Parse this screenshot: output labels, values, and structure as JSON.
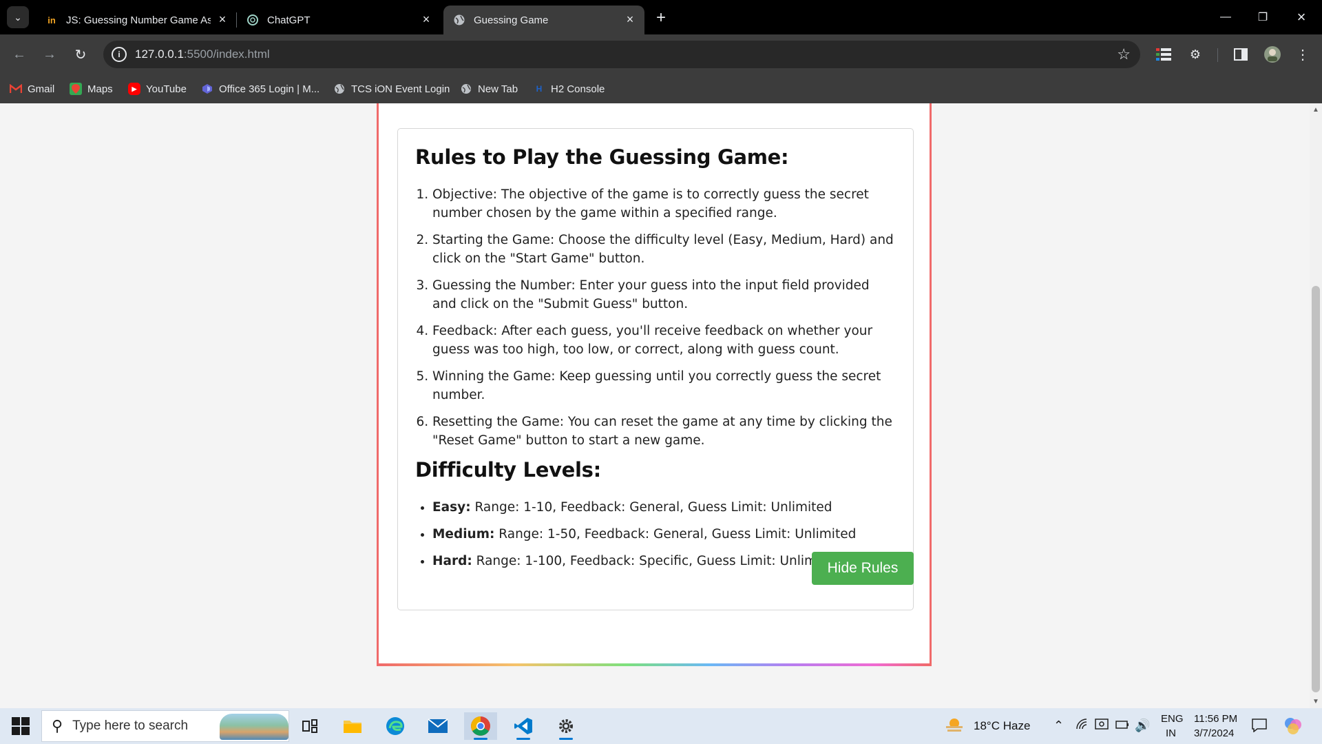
{
  "browser": {
    "tabs": [
      {
        "title": "JS: Guessing Number Game Ass",
        "favicon": "in",
        "active": false
      },
      {
        "title": "ChatGPT",
        "favicon": "openai-icon",
        "active": false
      },
      {
        "title": "Guessing Game",
        "favicon": "globe-icon",
        "active": true
      }
    ],
    "url_host": "127.0.0.1",
    "url_path": ":5500/index.html",
    "bookmarks": [
      {
        "label": "Gmail"
      },
      {
        "label": "Maps"
      },
      {
        "label": "YouTube"
      },
      {
        "label": "Office 365 Login | M..."
      },
      {
        "label": "TCS iON Event Login"
      },
      {
        "label": "New Tab"
      },
      {
        "label": "H2 Console"
      }
    ]
  },
  "page": {
    "rules_title": "Rules to Play the Guessing Game:",
    "rules": [
      "Objective: The objective of the game is to correctly guess the secret number chosen by the game within a specified range.",
      "Starting the Game: Choose the difficulty level (Easy, Medium, Hard) and click on the \"Start Game\" button.",
      "Guessing the Number: Enter your guess into the input field provided and click on the \"Submit Guess\" button.",
      "Feedback: After each guess, you'll receive feedback on whether your guess was too high, too low, or correct, along with guess count.",
      "Winning the Game: Keep guessing until you correctly guess the secret number.",
      "Resetting the Game: You can reset the game at any time by clicking the \"Reset Game\" button to start a new game."
    ],
    "difficulty_title": "Difficulty Levels:",
    "levels": [
      {
        "name": "Easy:",
        "desc": "Range: 1-10, Feedback: General, Guess Limit: Unlimited"
      },
      {
        "name": "Medium:",
        "desc": "Range: 1-50, Feedback: General, Guess Limit: Unlimited"
      },
      {
        "name": "Hard:",
        "desc": "Range: 1-100, Feedback: Specific, Guess Limit: Unlimited"
      }
    ],
    "hide_rules_label": "Hide Rules",
    "colors": {
      "accent_button": "#4caf50",
      "container_border": "#f06a6a"
    }
  },
  "taskbar": {
    "search_placeholder": "Type here to search",
    "weather": "18°C  Haze",
    "lang_top": "ENG",
    "lang_bottom": "IN",
    "time": "11:56 PM",
    "date": "3/7/2024"
  }
}
